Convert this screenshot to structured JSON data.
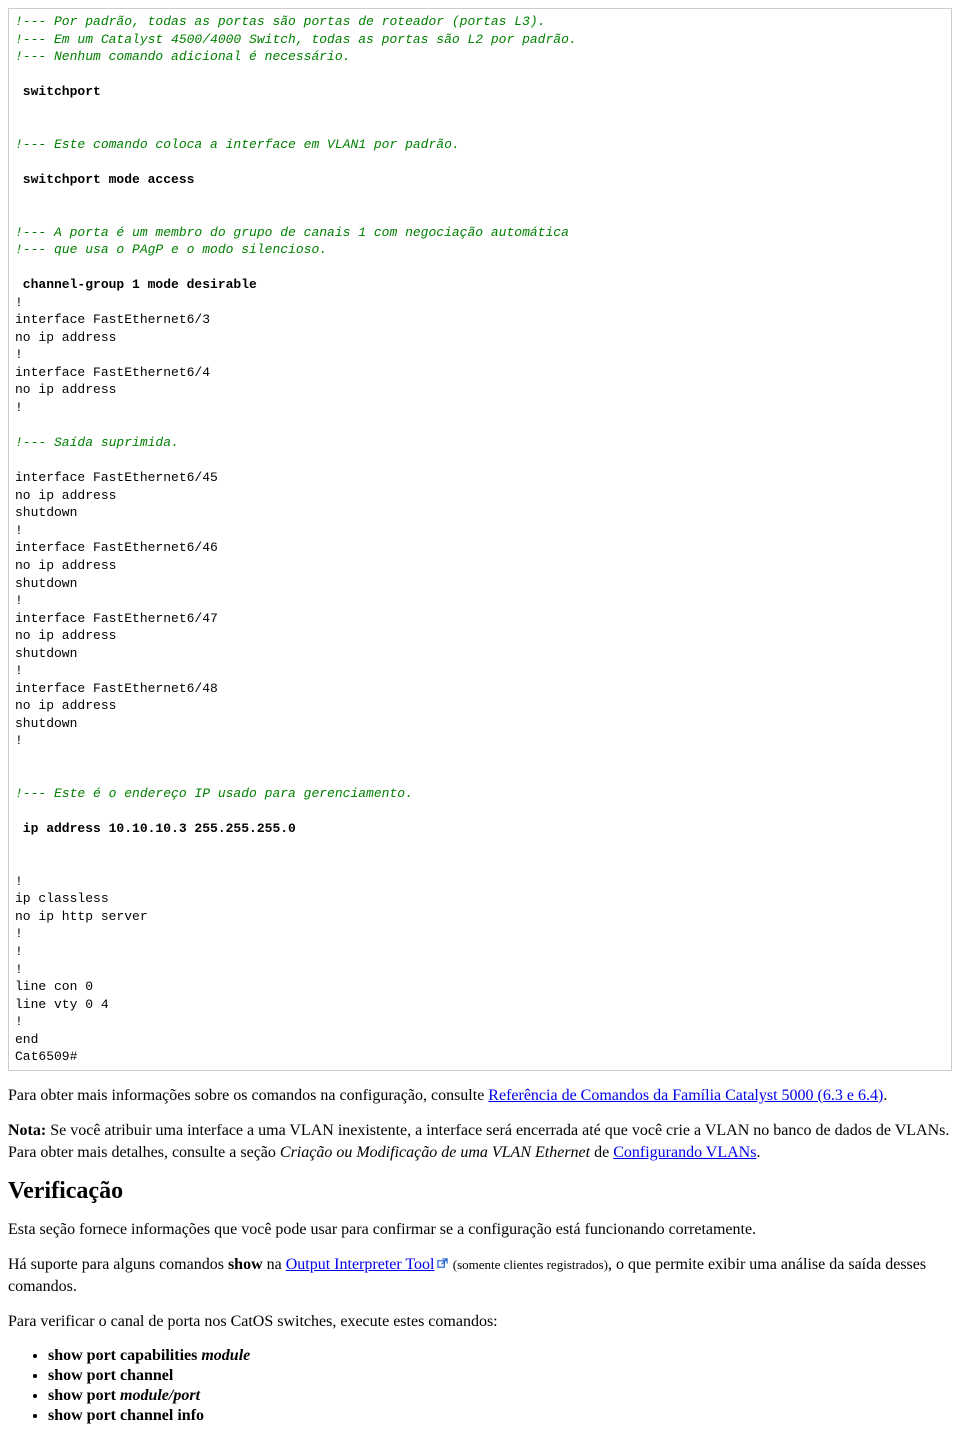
{
  "code": {
    "c1": "!--- Por padrão, todas as portas são portas de roteador (portas L3).",
    "c2": "!--- Em um Catalyst 4500/4000 Switch, todas as portas são L2 por padrão.",
    "c3": "!--- Nenhum comando adicional é necessário.",
    "b1": " switchport",
    "c4": "!--- Este comando coloca a interface em VLAN1 por padrão.",
    "b2": " switchport mode access",
    "c5": "!--- A porta é um membro do grupo de canais 1 com negociação automática",
    "c6": "!--- que usa o PAgP e o modo silencioso.",
    "b3": " channel-group 1 mode desirable",
    "l01": "!",
    "l02": "interface FastEthernet6/3",
    "l03": "no ip address",
    "l04": "!",
    "l05": "interface FastEthernet6/4",
    "l06": "no ip address",
    "l07": "!",
    "c7": "!--- Saída suprimida.",
    "l08": "interface FastEthernet6/45",
    "l09": "no ip address",
    "l10": "shutdown",
    "l11": "!",
    "l12": "interface FastEthernet6/46",
    "l13": "no ip address",
    "l14": "shutdown",
    "l15": "!",
    "l16": "interface FastEthernet6/47",
    "l17": "no ip address",
    "l18": "shutdown",
    "l19": "!",
    "l20": "interface FastEthernet6/48",
    "l21": "no ip address",
    "l22": "shutdown",
    "l23": "!",
    "c8": "!--- Este é o endereço IP usado para gerenciamento.",
    "b4": " ip address 10.10.10.3 255.255.255.0",
    "l24": "!",
    "l25": "ip classless",
    "l26": "no ip http server",
    "l27": "!",
    "l28": "!",
    "l29": "!",
    "l30": "line con 0",
    "l31": "line vty 0 4",
    "l32": "!",
    "l33": "end",
    "l34": "Cat6509#"
  },
  "para1": {
    "t1": "Para obter mais informações sobre os comandos na configuração, consulte ",
    "link": "Referência de Comandos da Família Catalyst 5000 (6.3 e 6.4)",
    "t2": "."
  },
  "para2": {
    "notaLabel": "Nota:",
    "t1": " Se você atribuir uma interface a uma VLAN inexistente, a interface será encerrada até que você crie a VLAN no banco de dados de VLANs. Para obter mais detalhes, consulte a seção ",
    "em": "Criação ou Modificação de uma VLAN Ethernet",
    "t2": " de ",
    "link": "Configurando VLANs",
    "t3": "."
  },
  "h_verificacao": "Verificação",
  "para3": "Esta seção fornece informações que você pode usar para confirmar se a configuração está funcionando corretamente.",
  "para4": {
    "t1": "Há suporte para alguns comandos ",
    "b1": "show",
    "t2": " na ",
    "link": "Output Interpreter Tool",
    "small": " (somente clientes registrados)",
    "t3": ", o que permite exibir uma análise da saída desses comandos."
  },
  "para5": "Para verificar o canal de porta nos CatOS switches, execute estes comandos:",
  "list": {
    "i1b": "show port capabilities ",
    "i1i": "module",
    "i2b": "show port channel",
    "i3b": "show port ",
    "i3i": "module/port",
    "i4b": "show port channel info"
  }
}
